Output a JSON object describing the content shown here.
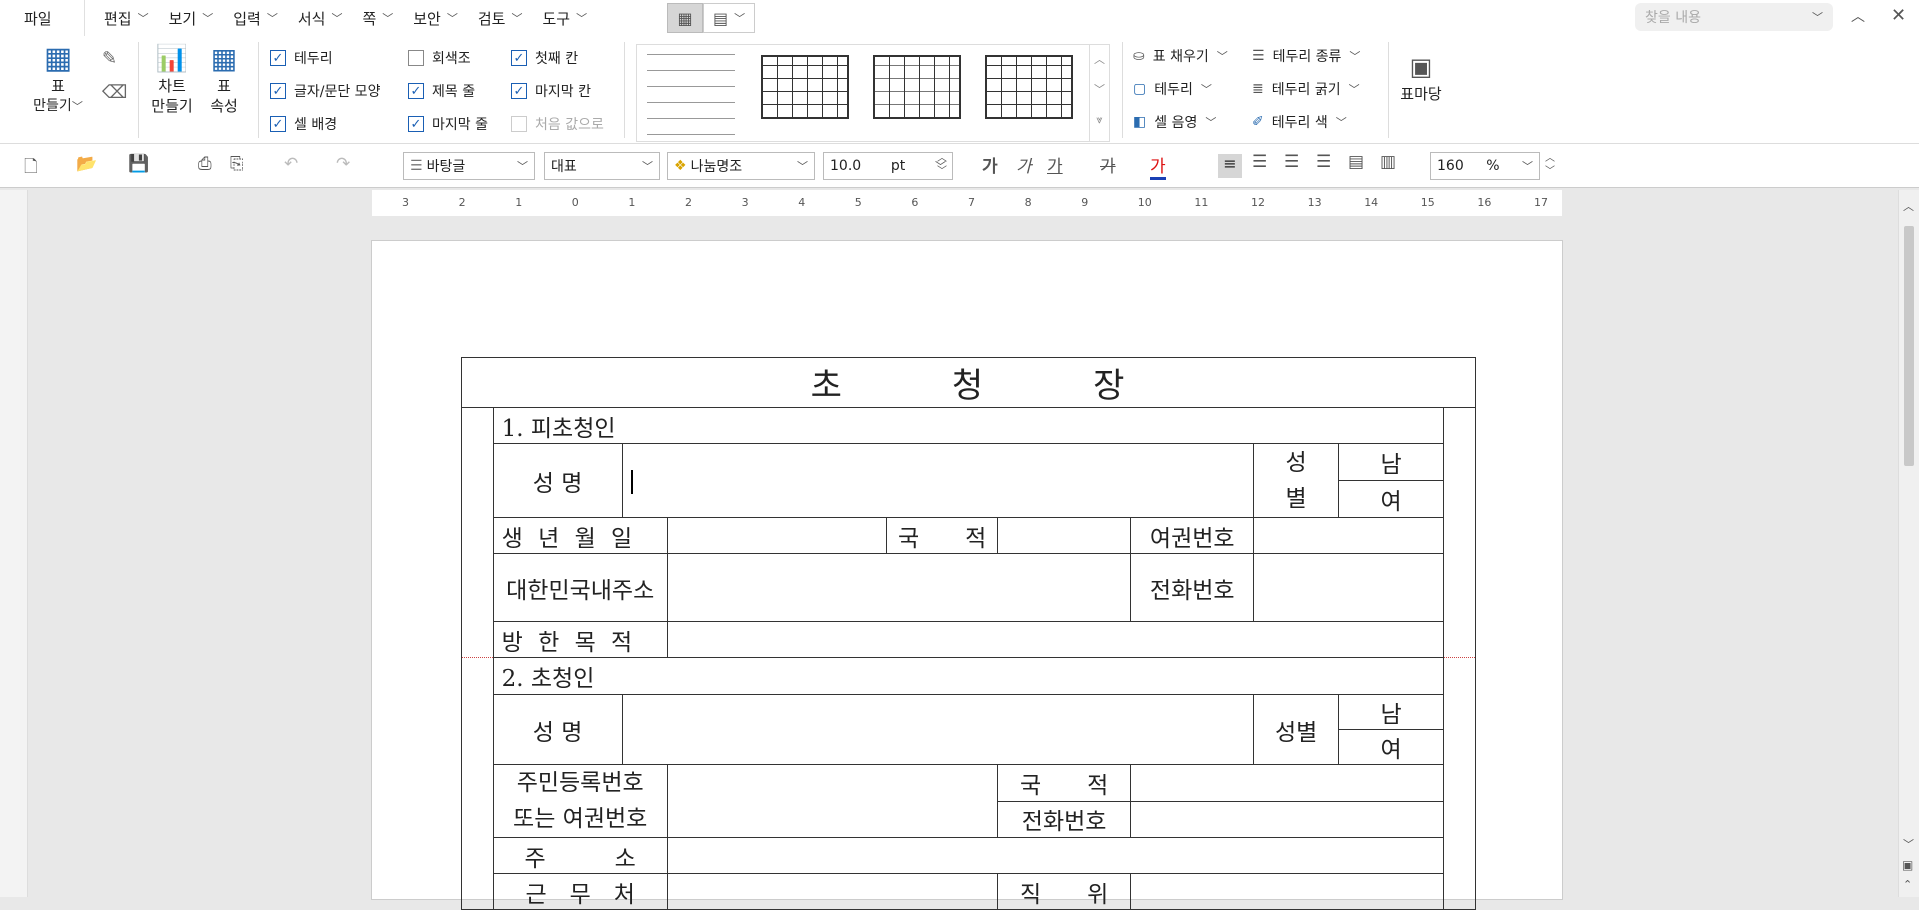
{
  "menu": {
    "file": "파일",
    "items": [
      "편집",
      "보기",
      "입력",
      "서식",
      "쪽",
      "보안",
      "검토",
      "도구"
    ],
    "search_placeholder": "찾을 내용"
  },
  "ribbon": {
    "table_make": {
      "line1": "표",
      "line2": "만들기"
    },
    "chart_make": {
      "line1": "차트",
      "line2": "만들기"
    },
    "table_props": {
      "line1": "표",
      "line2": "속성"
    },
    "checks": [
      {
        "label": "테두리",
        "checked": true
      },
      {
        "label": "글자/문단 모양",
        "checked": true
      },
      {
        "label": "셀 배경",
        "checked": true
      },
      {
        "label": "회색조",
        "checked": false
      },
      {
        "label": "제목 줄",
        "checked": true
      },
      {
        "label": "마지막 줄",
        "checked": true
      },
      {
        "label": "첫째 칸",
        "checked": true
      },
      {
        "label": "마지막 칸",
        "checked": true
      },
      {
        "label": "처음 값으로",
        "checked": false,
        "disabled": true
      }
    ],
    "fill": "표 채우기",
    "border": "테두리",
    "cell_shade": "셀 음영",
    "border_type": "테두리 종류",
    "border_width": "테두리 굵기",
    "border_color": "테두리 색",
    "table_slide": "표마당"
  },
  "toolbar": {
    "style": "바탕글",
    "lang": "대표",
    "font": "나눔명조",
    "size": "10.0",
    "unit": "pt",
    "zoom": "160",
    "zoom_unit": "%",
    "fmt": [
      "가",
      "가",
      "가",
      "가",
      "가"
    ]
  },
  "ruler": {
    "ticks": [
      "3",
      "2",
      "1",
      "0",
      "1",
      "2",
      "3",
      "4",
      "5",
      "6",
      "7",
      "8",
      "9",
      "10",
      "11",
      "12",
      "13",
      "14",
      "15",
      "16",
      "17"
    ]
  },
  "form": {
    "title": "초　　　청　　　장",
    "section1": "1. 피초청인",
    "name": "성 명",
    "gender": "성\n별",
    "male": "남",
    "female": "여",
    "birth": "생 년 월 일",
    "nationality": "국　　적",
    "passport": "여권번호",
    "kr_address": "대한민국내주소",
    "phone": "전화번호",
    "purpose": "방 한 목 적",
    "section2": "2. 초청인",
    "name2": "성 명",
    "gender2": "성별",
    "id_line1": "주민등록번호",
    "id_line2": "또는 여권번호",
    "nationality2": "국　　적",
    "phone2": "전화번호",
    "address": "주　　　소",
    "workplace": "근　무　처",
    "position": "직　　위"
  }
}
